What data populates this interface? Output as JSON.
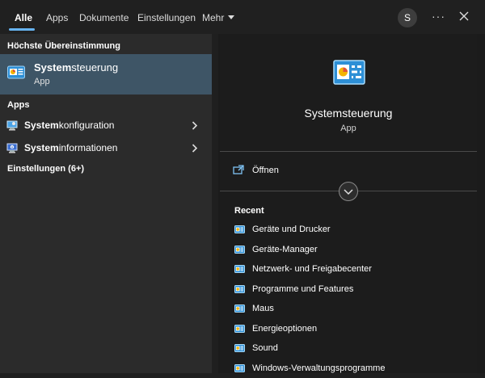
{
  "tabs": [
    {
      "label": "Alle",
      "active": true
    },
    {
      "label": "Apps"
    },
    {
      "label": "Dokumente"
    },
    {
      "label": "Einstellungen"
    },
    {
      "label": "Mehr"
    }
  ],
  "account": {
    "initial": "S"
  },
  "header_icons": {
    "more": "more-icon",
    "close": "close-icon"
  },
  "left": {
    "best_match_heading": "Höchste Übereinstimmung",
    "best_match": {
      "name_bold": "System",
      "name_rest": "steuerung",
      "type": "App"
    },
    "apps_heading": "Apps",
    "apps": [
      {
        "name_bold": "System",
        "name_rest": "konfiguration"
      },
      {
        "name_bold": "System",
        "name_rest": "informationen"
      }
    ],
    "settings_heading": "Einstellungen (6+)"
  },
  "right": {
    "title": "Systemsteuerung",
    "subtitle": "App",
    "open_label": "Öffnen",
    "recent_heading": "Recent",
    "recent": [
      "Geräte und Drucker",
      "Geräte-Manager",
      "Netzwerk- und Freigabecenter",
      "Programme und Features",
      "Maus",
      "Energieoptionen",
      "Sound",
      "Windows-Verwaltungsprogramme"
    ]
  },
  "colors": {
    "accent": "#66b3f0",
    "selected_row": "#3e5566"
  }
}
